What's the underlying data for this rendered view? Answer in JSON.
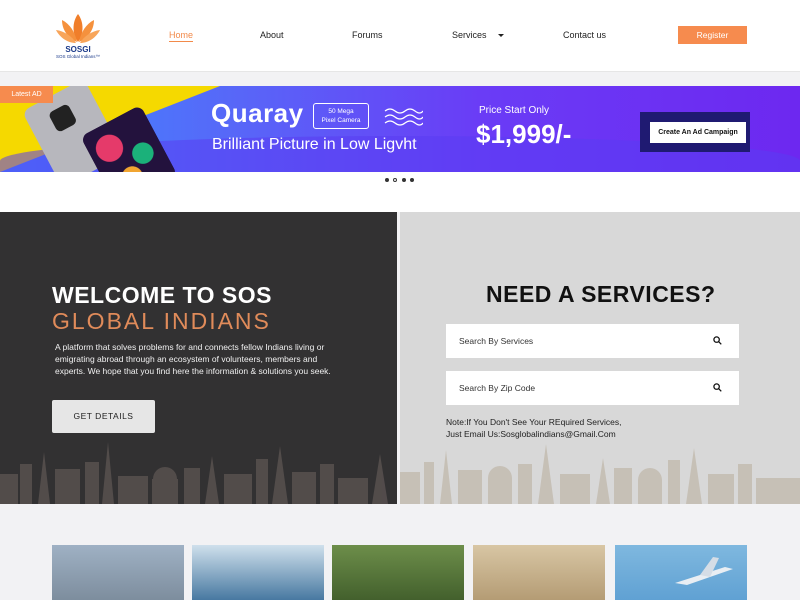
{
  "header": {
    "logo_text": "SOSGI",
    "logo_subtext": "SOS Global Indians™",
    "nav": {
      "home": "Home",
      "about": "About",
      "forums": "Forums",
      "services": "Services",
      "contact": "Contact us"
    },
    "register_label": "Register"
  },
  "banner": {
    "tag": "Latest AD",
    "brand": "Quaray",
    "camera_badge_line1": "50 Mega",
    "camera_badge_line2": "Pixel Camera",
    "tagline": "Brilliant Picture in Low Ligvht",
    "price_label": "Price Start Only",
    "price": "$1,999/-",
    "campaign_button": "Create An Ad Campaign",
    "slides_total": 4,
    "slide_active": 1
  },
  "welcome": {
    "title_line1": "WELCOME TO SOS",
    "title_line2": "GLOBAL INDIANS",
    "description": "A platform that solves problems for and connects fellow Indians living or emigrating abroad through an ecosystem of volunteers, members and experts. We hope that you find here the information & solutions you seek.",
    "button_label": "GET DETAILS"
  },
  "services_panel": {
    "title": "NEED A SERVICES?",
    "search_services_placeholder": "Search By Services",
    "search_zip_placeholder": "Search By Zip Code",
    "note_line1": "Note:If You Don't See Your REquired Services,",
    "note_line2": "Just Email Us:Sosglobalindians@Gmail.Com"
  },
  "colors": {
    "accent": "#f68b4e",
    "dark_panel": "#323132",
    "light_panel": "#d8d8d8",
    "banner_purple": "#6d28f0"
  },
  "icons": [
    "lotus-logo-icon",
    "chevron-down-icon",
    "search-icon"
  ]
}
